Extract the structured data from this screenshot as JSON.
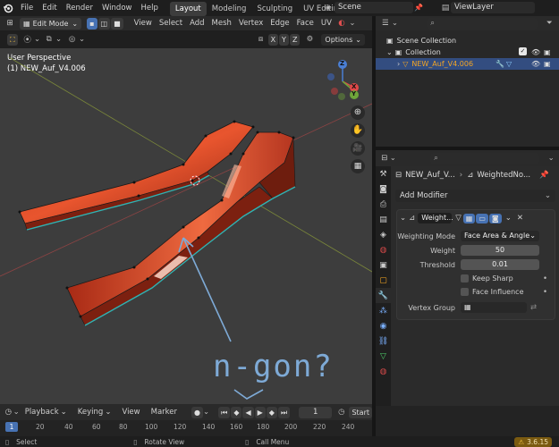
{
  "topbar": {
    "menus": [
      "File",
      "Edit",
      "Render",
      "Window",
      "Help"
    ],
    "workspaces": [
      "Layout",
      "Modeling",
      "Sculpting",
      "UV Editing"
    ],
    "active_workspace": "Layout",
    "scene": "Scene",
    "viewlayer": "ViewLayer"
  },
  "vp_header": {
    "mode": "Edit Mode",
    "menus": [
      "View",
      "Select",
      "Add",
      "Mesh",
      "Vertex",
      "Edge",
      "Face",
      "UV"
    ],
    "axes": [
      "X",
      "Y",
      "Z"
    ],
    "options": "Options"
  },
  "viewport": {
    "view_name": "User Perspective",
    "object_line": "(1) NEW_Auf_V4.006",
    "gizmo": {
      "x": "X",
      "y": "Y",
      "z": "Z"
    },
    "annotation": "n-gon?"
  },
  "outliner": {
    "scene_collection": "Scene Collection",
    "collection": "Collection",
    "object": "NEW_Auf_V4.006"
  },
  "properties": {
    "breadcrumb_object": "NEW_Auf_V...",
    "breadcrumb_modifier": "WeightedNo...",
    "add_modifier": "Add Modifier",
    "modifier_name": "Weight...",
    "fields": {
      "weighting_mode_label": "Weighting Mode",
      "weighting_mode_value": "Face Area & Angle",
      "weight_label": "Weight",
      "weight_value": "50",
      "threshold_label": "Threshold",
      "threshold_value": "0.01",
      "keep_sharp": "Keep Sharp",
      "face_influence": "Face Influence",
      "vertex_group_label": "Vertex Group"
    }
  },
  "timeline": {
    "menus": [
      "Playback",
      "Keying",
      "View",
      "Marker"
    ],
    "current_frame": "1",
    "start_label": "Start",
    "frame_marks": [
      "1",
      "20",
      "40",
      "60",
      "80",
      "100",
      "120",
      "140",
      "160",
      "180",
      "200",
      "220",
      "240"
    ]
  },
  "statusbar": {
    "select": "Select",
    "rotate": "Rotate View",
    "call_menu": "Call Menu",
    "version": "3.6.15"
  },
  "colors": {
    "accent_blue": "#4772b3",
    "mesh_orange": "#e8492a",
    "active_object": "#f5a623"
  }
}
